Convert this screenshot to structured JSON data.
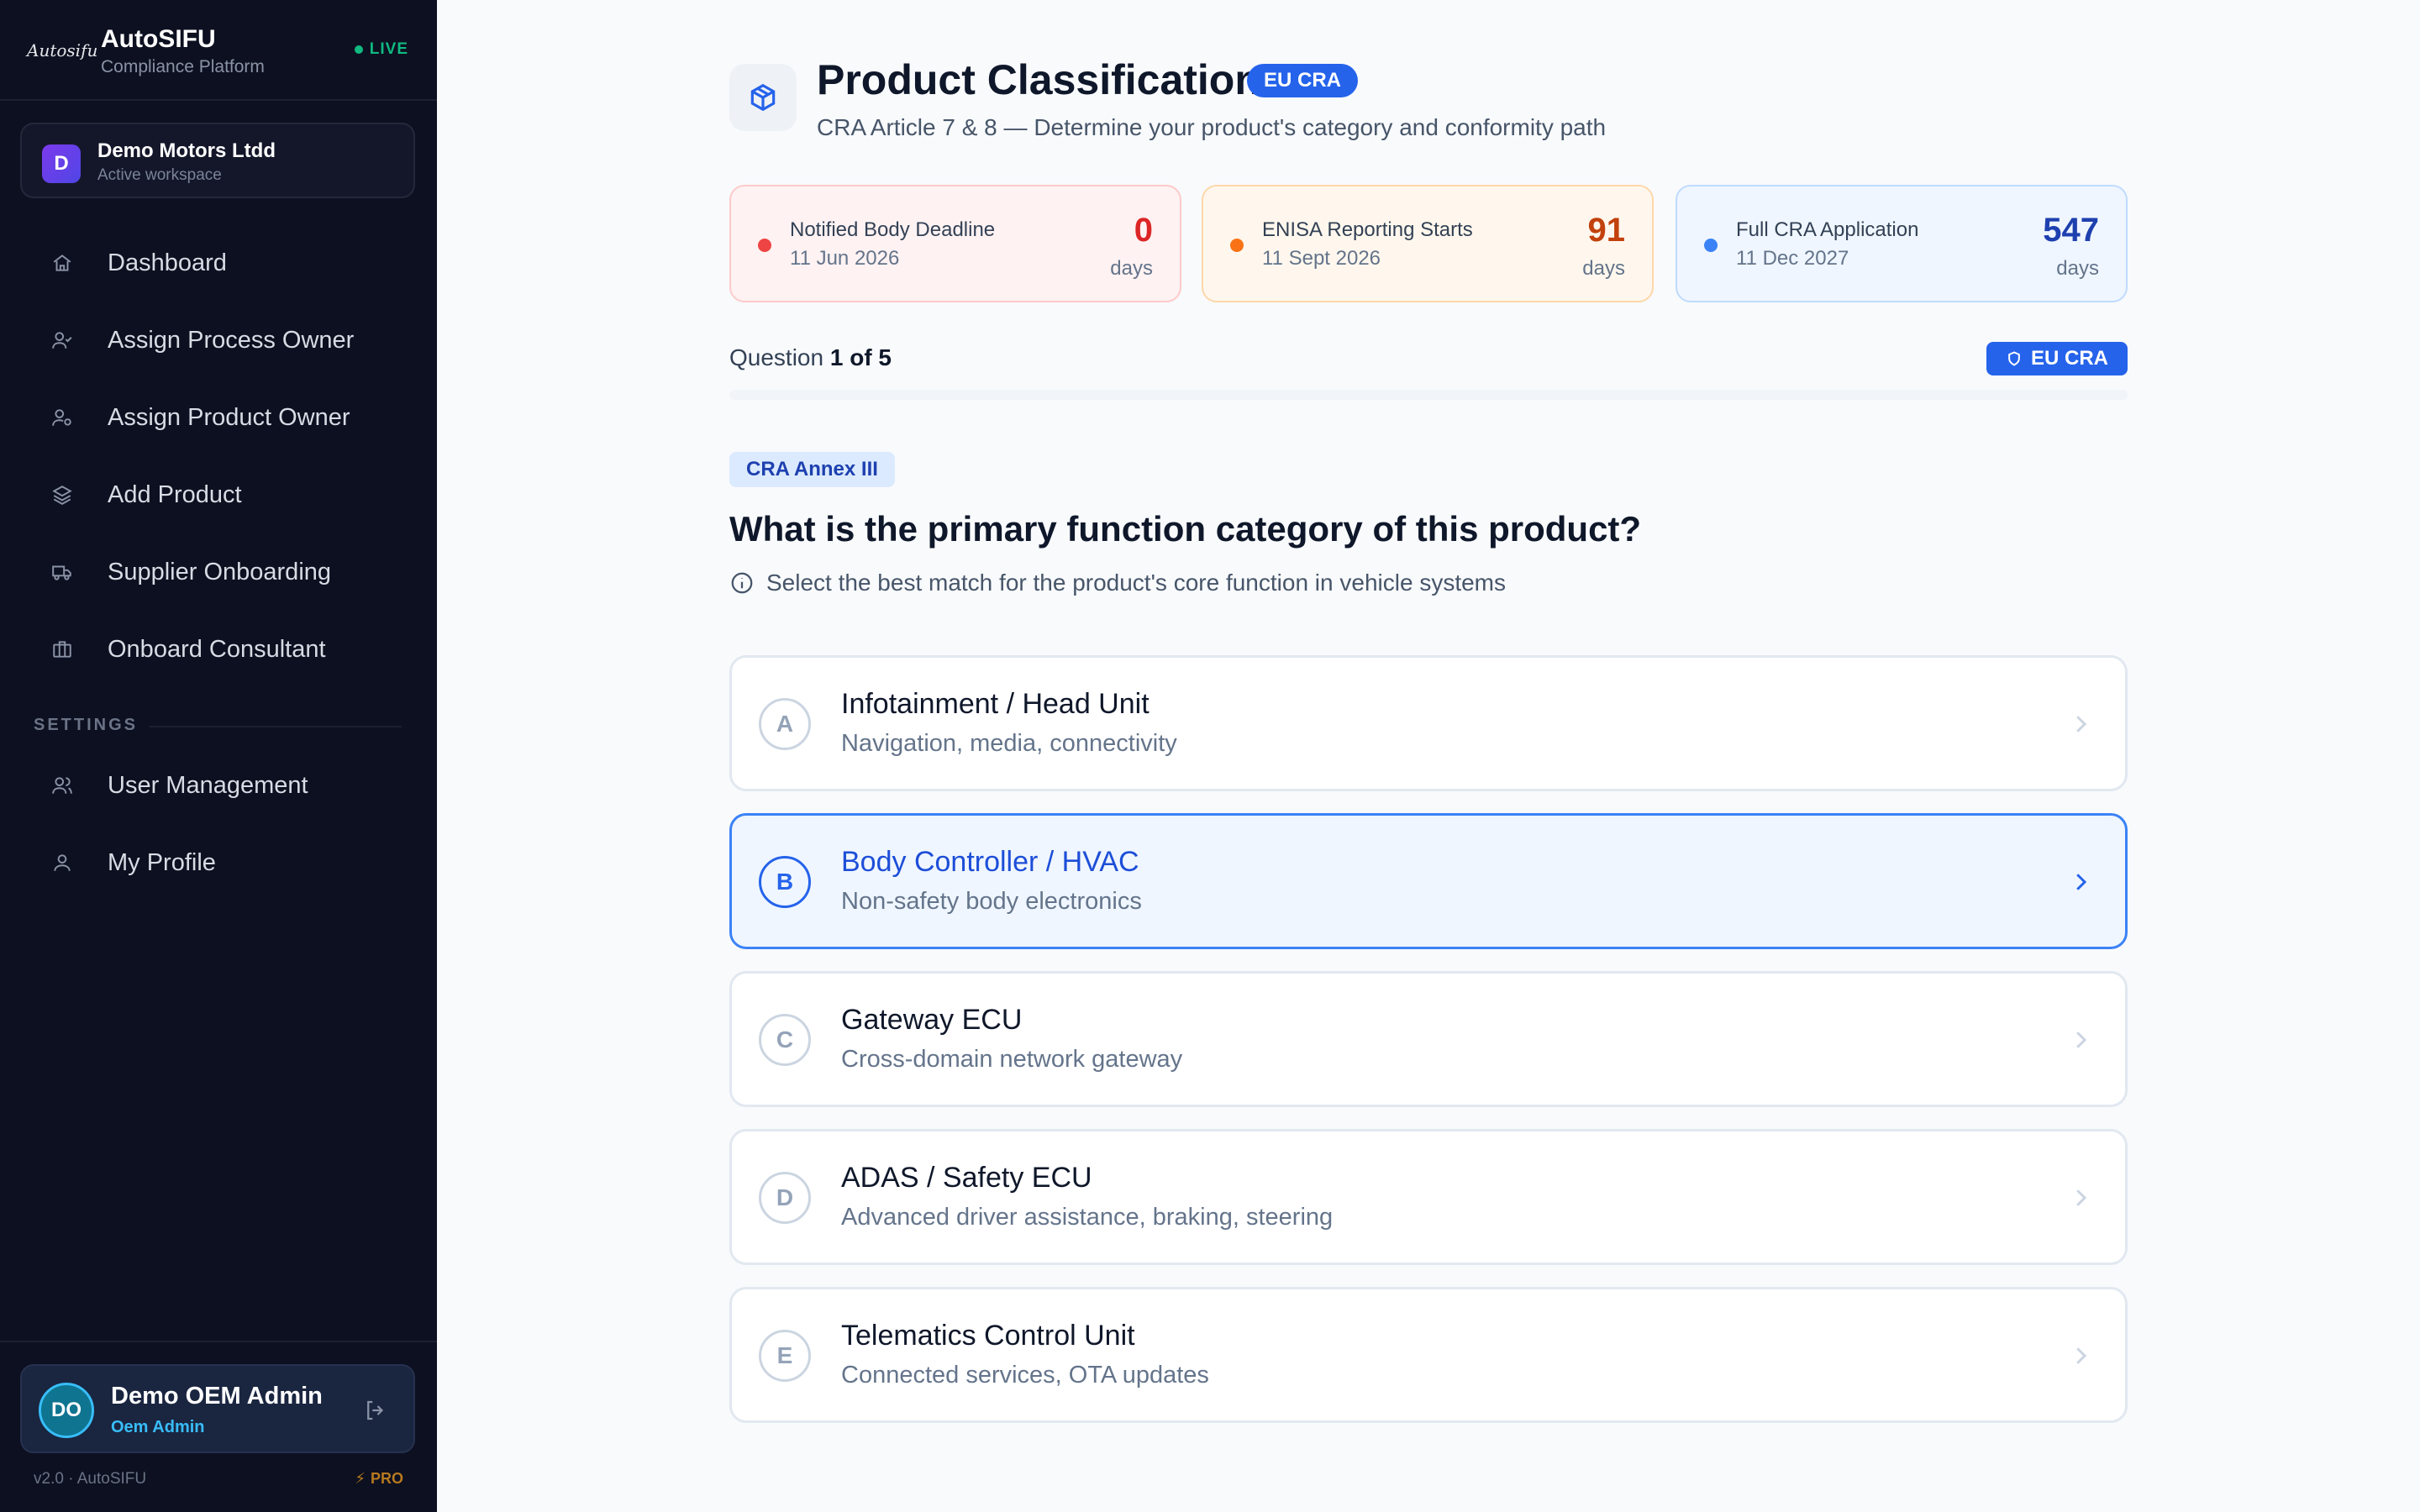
{
  "sidebar": {
    "brand": {
      "logo": "Autosifu",
      "name": "AutoSIFU",
      "subtitle": "Compliance Platform",
      "status": "LIVE"
    },
    "workspace": {
      "initial": "D",
      "name": "Demo Motors Ltdd",
      "subtitle": "Active workspace"
    },
    "nav": [
      {
        "label": "Dashboard",
        "icon": "home-icon"
      },
      {
        "label": "Assign Process Owner",
        "icon": "user-check-icon"
      },
      {
        "label": "Assign Product Owner",
        "icon": "user-cog-icon"
      },
      {
        "label": "Add Product",
        "icon": "layers-icon"
      },
      {
        "label": "Supplier Onboarding",
        "icon": "truck-icon"
      },
      {
        "label": "Onboard Consultant",
        "icon": "briefcase-icon"
      }
    ],
    "settings_label": "SETTINGS",
    "settings": [
      {
        "label": "User Management",
        "icon": "users-icon"
      },
      {
        "label": "My Profile",
        "icon": "user-icon"
      }
    ],
    "user": {
      "initials": "DO",
      "name": "Demo OEM Admin",
      "role": "Oem Admin"
    },
    "version": "v2.0 · AutoSIFU",
    "plan": "PRO"
  },
  "header": {
    "title": "Product Classification",
    "badge": "EU CRA",
    "subtitle": "CRA Article 7 & 8 — Determine your product's category and conformity path"
  },
  "deadlines": [
    {
      "title": "Notified Body Deadline",
      "date": "11 Jun 2026",
      "value": "0",
      "unit": "days",
      "color": "#dc2626"
    },
    {
      "title": "ENISA Reporting Starts",
      "date": "11 Sept 2026",
      "value": "91",
      "unit": "days",
      "color": "#c2410c"
    },
    {
      "title": "Full CRA Application",
      "date": "11 Dec 2027",
      "value": "547",
      "unit": "days",
      "color": "#1e40af"
    }
  ],
  "progress": {
    "prefix": "Question",
    "current": "1",
    "of": "of 5",
    "fraction": 0.0,
    "badge": "EU CRA"
  },
  "question": {
    "tag": "CRA Annex III",
    "title": "What is the primary function category of this product?",
    "hint": "Select the best match for the product's core function in vehicle systems",
    "options": [
      {
        "letter": "A",
        "title": "Infotainment / Head Unit",
        "desc": "Navigation, media, connectivity"
      },
      {
        "letter": "B",
        "title": "Body Controller / HVAC",
        "desc": "Non-safety body electronics"
      },
      {
        "letter": "C",
        "title": "Gateway ECU",
        "desc": "Cross-domain network gateway"
      },
      {
        "letter": "D",
        "title": "ADAS / Safety ECU",
        "desc": "Advanced driver assistance, braking, steering"
      },
      {
        "letter": "E",
        "title": "Telematics Control Unit",
        "desc": "Connected services, OTA updates"
      }
    ],
    "selected": "B"
  },
  "colors": {
    "accent": "#2563eb",
    "sidebar_bg": "#0d1020",
    "live": "#10b981"
  }
}
